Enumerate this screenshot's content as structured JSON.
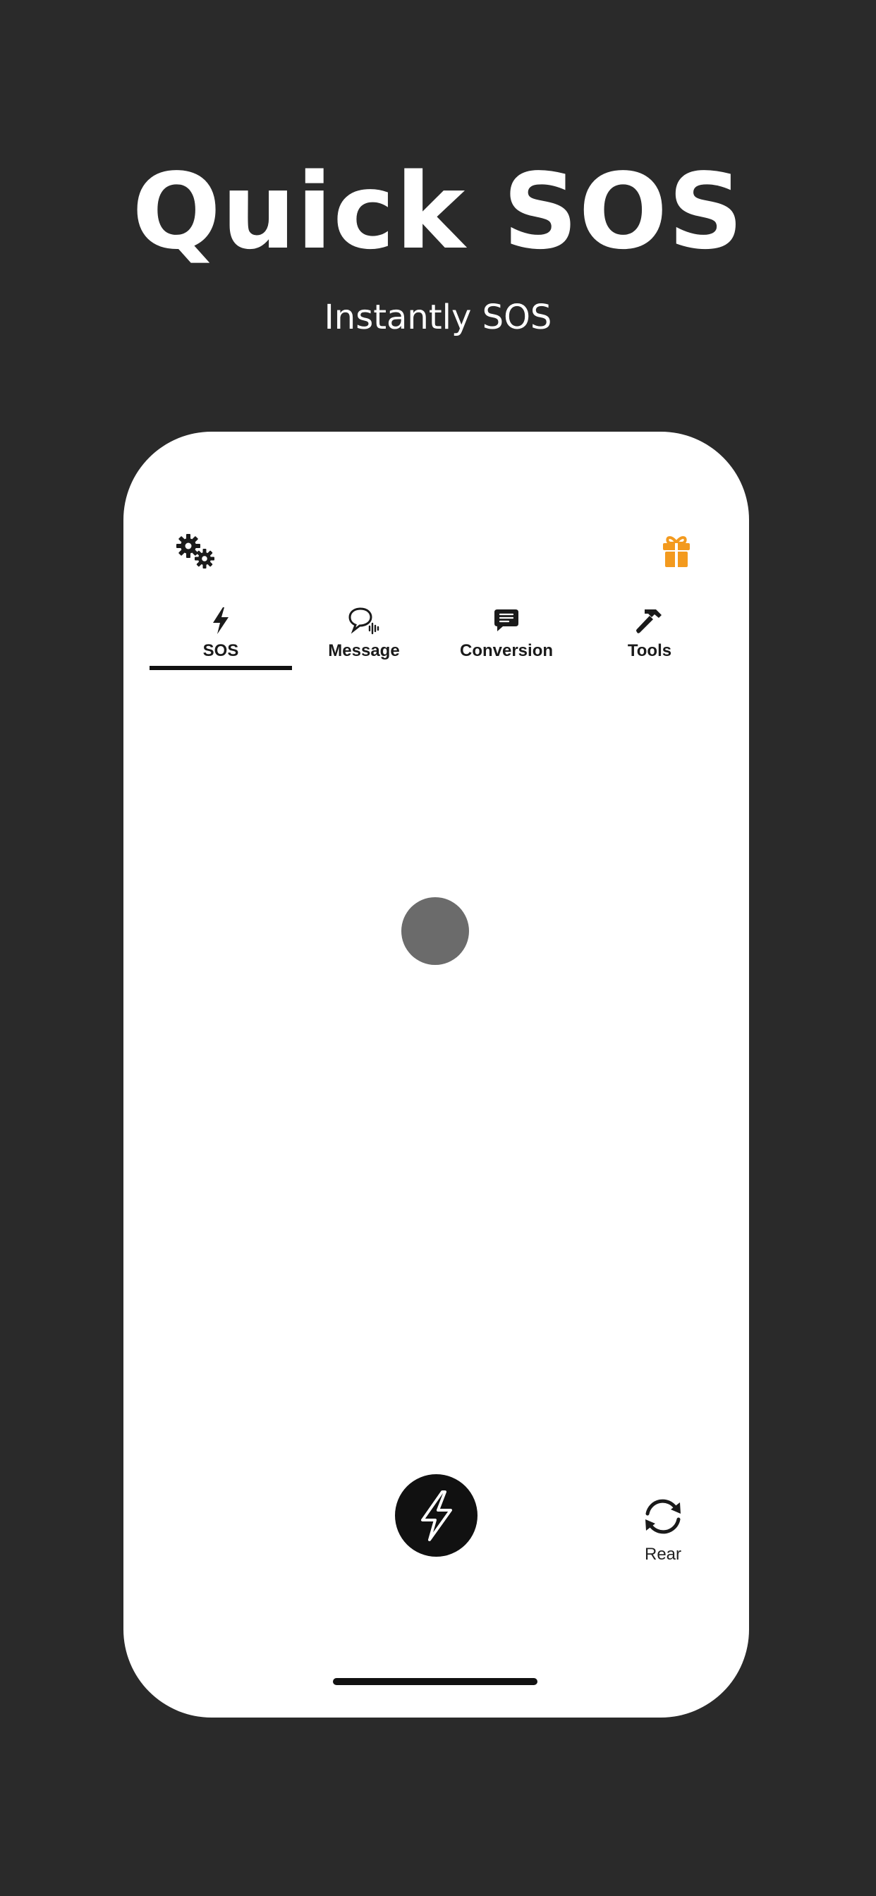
{
  "header": {
    "title": "Quick SOS",
    "subtitle": "Instantly SOS"
  },
  "toolbar": {
    "settings_icon": "gears-icon",
    "gift_icon": "gift-icon",
    "gift_color": "#F39A1E"
  },
  "tabs": [
    {
      "label": "SOS",
      "icon": "bolt-icon",
      "selected": true
    },
    {
      "label": "Message",
      "icon": "voice-bubble-icon",
      "selected": false
    },
    {
      "label": "Conversion",
      "icon": "chat-text-icon",
      "selected": false
    },
    {
      "label": "Tools",
      "icon": "hammer-icon",
      "selected": false
    }
  ],
  "main": {
    "indicator_color": "#6B6B6B",
    "flash_button_icon": "bolt-icon"
  },
  "camera": {
    "label": "Rear",
    "icon": "rotate-camera-icon"
  }
}
